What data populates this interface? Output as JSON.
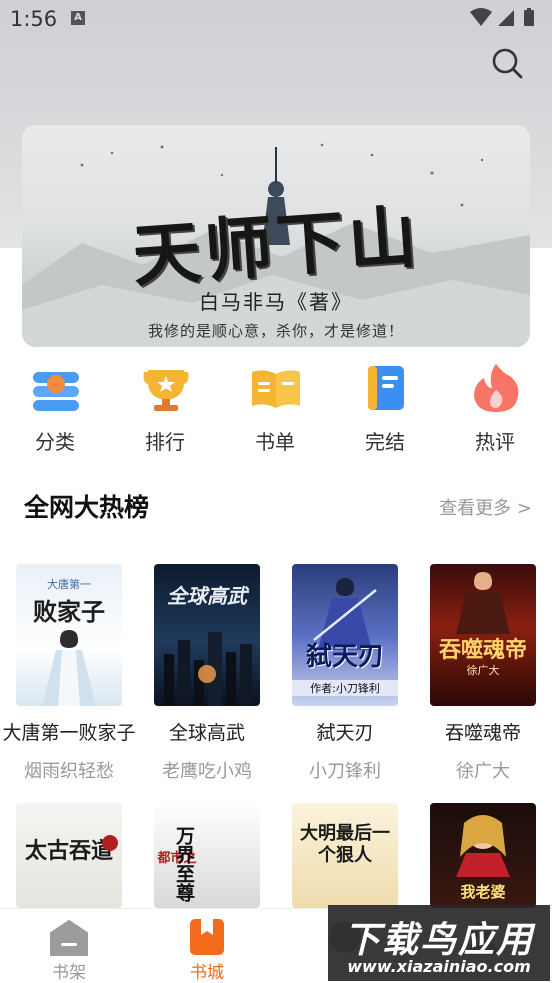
{
  "status_bar": {
    "time": "1:56",
    "notification_glyph": "A"
  },
  "search": {
    "icon": "search-icon"
  },
  "banner": {
    "title": "天师下山",
    "author": "白马非马《著》",
    "tagline": "我修的是顺心意，杀你，才是修道！"
  },
  "categories": [
    {
      "label": "分类",
      "icon": "category-icon"
    },
    {
      "label": "排行",
      "icon": "trophy-icon"
    },
    {
      "label": "书单",
      "icon": "book-list-icon"
    },
    {
      "label": "完结",
      "icon": "completed-book-icon"
    },
    {
      "label": "热评",
      "icon": "flame-icon"
    }
  ],
  "section": {
    "title": "全网大热榜",
    "more": "查看更多 >"
  },
  "books_row1": [
    {
      "title": "大唐第一败家子",
      "author": "烟雨织轻愁",
      "cover_text": "败家子",
      "cover_sub": "大唐第一"
    },
    {
      "title": "全球高武",
      "author": "老鹰吃小鸡",
      "cover_text": "全球高武",
      "cover_sub": ""
    },
    {
      "title": "弑天刃",
      "author": "小刀锋利",
      "cover_text": "弑天刃",
      "cover_sub": "作者:小刀锋利"
    },
    {
      "title": "吞噬魂帝",
      "author": "徐广大",
      "cover_text": "吞噬魂帝",
      "cover_sub": "徐广大"
    }
  ],
  "books_row2": [
    {
      "cover_text": "太古吞道",
      "cover_sub": ""
    },
    {
      "cover_text": "万界至尊",
      "cover_sub": "都市之"
    },
    {
      "cover_text": "大明最后一个狠人",
      "cover_sub": ""
    },
    {
      "cover_text": "我老婆",
      "cover_sub": ""
    }
  ],
  "bottom_nav": [
    {
      "label": "书架",
      "icon": "bookshelf-icon",
      "active": false
    },
    {
      "label": "书城",
      "icon": "bookstore-icon",
      "active": true
    },
    {
      "label": "",
      "icon": "discover-icon",
      "active": false
    },
    {
      "label": "",
      "icon": "profile-icon",
      "active": false
    }
  ],
  "watermark": {
    "big": "下载鸟应用",
    "small": "www.xiazainiao.com"
  },
  "colors": {
    "accent": "#f26b1d",
    "inactive": "#999999",
    "text": "#222222"
  }
}
